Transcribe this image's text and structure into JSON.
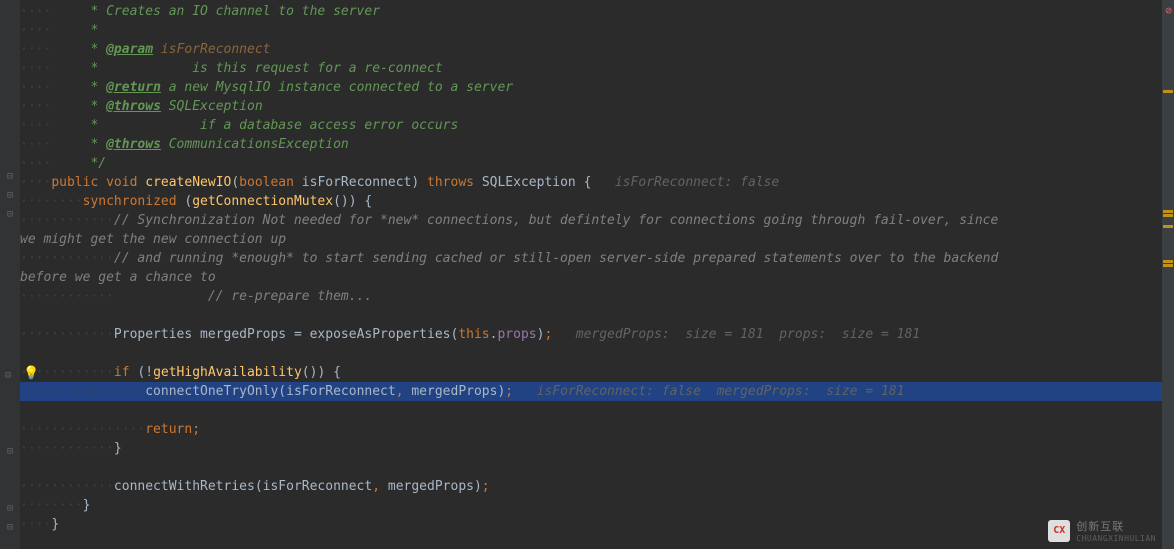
{
  "code": {
    "l1": "     * Creates an IO channel to the server",
    "l2": "     * ",
    "l3a": "     * ",
    "l3tag": "@param",
    "l3b": " isForReconnect",
    "l4": "     *            is this request for a re-connect",
    "l5a": "     * ",
    "l5tag": "@return",
    "l5b": " a new MysqlIO instance connected to a server",
    "l6a": "     * ",
    "l6tag": "@throws",
    "l6b": " SQLException",
    "l7": "     *             if a database access error occurs",
    "l8a": "     * ",
    "l8tag": "@throws",
    "l8b": " CommunicationsException",
    "l9": "     */",
    "l10_kw1": "public",
    "l10_kw2": "void",
    "l10_method": "createNewIO",
    "l10_kw3": "boolean",
    "l10_param": "isForReconnect",
    "l10_kw4": "throws",
    "l10_ex": "SQLException",
    "l10_hint": "isForReconnect: false",
    "l11_kw": "synchronized",
    "l11_method": "getConnectionMutex",
    "l12": "            // Synchronization Not needed for *new* connections, but defintely for connections going through fail-over, since we might get the new connection up",
    "l13": "            // and running *enough* to start sending cached or still-open server-side prepared statements over to the backend before we get a chance to",
    "l14": "            // re-prepare them...",
    "l15_type": "Properties",
    "l15_var": "mergedProps",
    "l15_method": "exposeAsProperties",
    "l15_kw": "this",
    "l15_field": "props",
    "l15_hint": "mergedProps:  size = 181  props:  size = 181",
    "l16_kw": "if",
    "l16_method": "getHighAvailability",
    "l17_method": "connectOneTryOnly",
    "l17_arg1": "isForReconnect",
    "l17_arg2": "mergedProps",
    "l17_hint": "isForReconnect: false  mergedProps:  size = 181",
    "l18_kw": "return",
    "l19_method": "connectWithRetries",
    "l19_arg1": "isForReconnect",
    "l19_arg2": "mergedProps"
  },
  "ws": {
    "dot4": "····",
    "dot8": "········",
    "dot12": "············",
    "dot16": "················"
  },
  "watermark": {
    "badge": "CX",
    "text": "创新互联",
    "sub": "CHUANGXINHULIAN"
  }
}
